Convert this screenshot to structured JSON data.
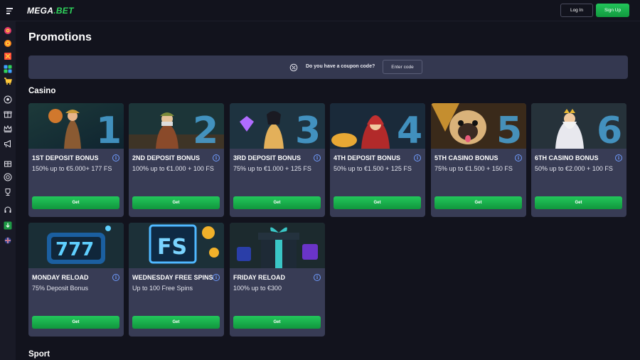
{
  "header": {
    "logo_main": "MEGA",
    "logo_accent": ".BET",
    "login_label": "Log In",
    "signup_label": "Sign Up"
  },
  "sidebar": {
    "icons": [
      "roulette-icon",
      "target-icon",
      "flag-icon",
      "apps-icon",
      "cart-icon",
      "soccer-ball-icon",
      "gift-icon",
      "crown-icon",
      "megaphone-icon",
      "giftbox-icon",
      "lifebuoy-icon",
      "trophy-icon",
      "headset-icon",
      "download-icon",
      "flag-uk-icon"
    ]
  },
  "main": {
    "title": "Promotions",
    "coupon": {
      "question": "Do you have a coupon code?",
      "button_label": "Enter code"
    },
    "casino_title": "Casino",
    "sport_title": "Sport",
    "info_glyph": "i",
    "cards": [
      {
        "title": "1ST DEPOSIT BONUS",
        "desc": "150% up to €5.000+ 177 FS",
        "button": "Get",
        "art": "adventurer"
      },
      {
        "title": "2ND DEPOSIT BONUS",
        "desc": "100% up to €1.000 + 100 FS",
        "button": "Get",
        "art": "miner"
      },
      {
        "title": "3RD DEPOSIT BONUS",
        "desc": "75% up to €1.000 + 125 FS",
        "button": "Get",
        "art": "cleopatra"
      },
      {
        "title": "4TH DEPOSIT BONUS",
        "desc": "50% up to €1.500 + 125 FS",
        "button": "Get",
        "art": "sorceress"
      },
      {
        "title": "5TH CASINO BONUS",
        "desc": "75% up to €1.500 + 150 FS",
        "button": "Get",
        "art": "pug"
      },
      {
        "title": "6TH CASINO BONUS",
        "desc": "50% up to €2.000 + 100 FS",
        "button": "Get",
        "art": "zeus"
      },
      {
        "title": "MONDAY RELOAD",
        "desc": "75% Deposit Bonus",
        "button": "Get",
        "art": "slot-777"
      },
      {
        "title": "WEDNESDAY FREE SPINS",
        "desc": "Up to 100 Free Spins",
        "button": "Get",
        "art": "fs-sign"
      },
      {
        "title": "FRIDAY RELOAD",
        "desc": "100% up to €300",
        "button": "Get",
        "art": "gift-box"
      }
    ],
    "card_art_text": {
      "n1": "1",
      "n2": "2",
      "n3": "3",
      "n4": "4",
      "n5": "5",
      "n6": "6",
      "slot": "777",
      "fs": "FS"
    }
  },
  "colors": {
    "background": "#12131d",
    "card": "#383c55",
    "accent_green": "#22c45a",
    "info_blue": "#6f9cff"
  }
}
